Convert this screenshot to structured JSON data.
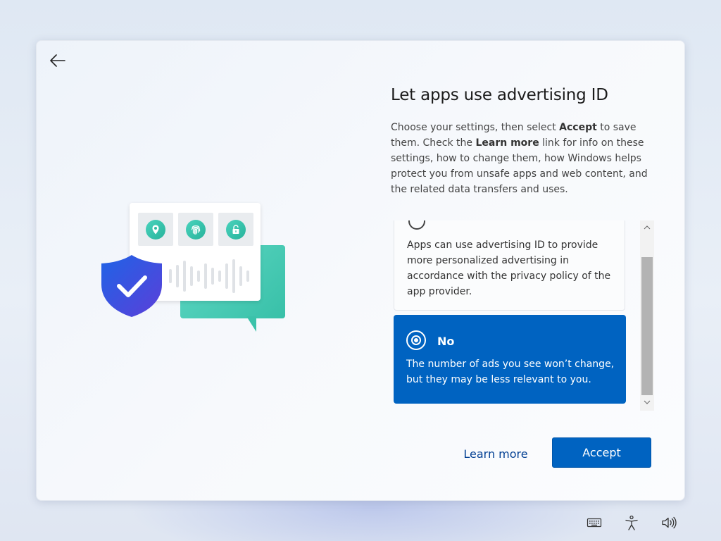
{
  "page": {
    "title": "Let apps use advertising ID",
    "description": {
      "part1": "Choose your settings, then select ",
      "accept_word": "Accept",
      "part2": " to save them. Check the ",
      "learn_more_word": "Learn more",
      "part3": " link for info on these settings, how to change them, how Windows helps protect you from unsafe apps and web content, and the related data transfers and uses."
    }
  },
  "options": {
    "yes": {
      "text": "Apps can use advertising ID to provide more personalized advertising in accordance with the privacy policy of the app provider.",
      "selected": false
    },
    "no": {
      "label": "No",
      "text": "The number of ads you see won’t change, but they may be less relevant to you.",
      "selected": true
    }
  },
  "buttons": {
    "learn_more": "Learn more",
    "accept": "Accept"
  },
  "icons": {
    "back": "back-arrow-icon",
    "tray": [
      "keyboard-icon",
      "accessibility-icon",
      "volume-icon"
    ],
    "illustration": [
      "location-pin-icon",
      "fingerprint-icon",
      "unlock-icon",
      "shield-check-icon",
      "sound-wave-icon"
    ]
  },
  "colors": {
    "accent": "#0063c1",
    "teal": "#38c0a8",
    "shield": "#2a55e0"
  }
}
